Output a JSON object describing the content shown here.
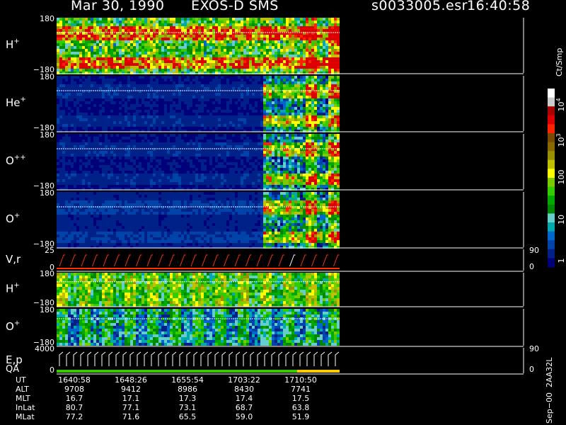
{
  "header": {
    "date": "Mar 30, 1990",
    "instrument": "EXOS-D SMS",
    "file": "s0033005.esr",
    "time": "16:40:58"
  },
  "panels": [
    {
      "label": "H",
      "sup": "+",
      "top_tick": "180",
      "bottom_tick": "−180"
    },
    {
      "label": "He",
      "sup": "+",
      "top_tick": "180",
      "bottom_tick": "−180"
    },
    {
      "label": "O",
      "sup": "++",
      "top_tick": "180",
      "bottom_tick": "−180"
    },
    {
      "label": "O",
      "sup": "+",
      "top_tick": "180",
      "bottom_tick": "−180"
    },
    {
      "label": "V,r",
      "sup": "",
      "top_tick": "25",
      "bottom_tick": "0",
      "right_top": "90",
      "right_bottom": "0"
    },
    {
      "label": "H",
      "sup": "+",
      "top_tick": "180",
      "bottom_tick": "−180"
    },
    {
      "label": "O",
      "sup": "+",
      "top_tick": "180",
      "bottom_tick": "−180"
    },
    {
      "label": "E,p",
      "sub_label": "QA",
      "top_tick": "4000",
      "bottom_tick": "0",
      "right_top": "90",
      "right_bottom": "0"
    }
  ],
  "colorbar": {
    "unit": "Ct/Smp",
    "labels": [
      "10",
      "10",
      "100",
      "10",
      "1"
    ],
    "sups": [
      "4",
      "3",
      "",
      "",
      ""
    ],
    "colors": [
      "#ffffff",
      "#cccccc",
      "#aa0000",
      "#dd0000",
      "#ff2200",
      "#7a4a00",
      "#8a6a00",
      "#9a9000",
      "#c0c000",
      "#ffff00",
      "#7acc00",
      "#33cc00",
      "#00aa00",
      "#008800",
      "#66cccc",
      "#00aaaa",
      "#0066cc",
      "#0044aa",
      "#002288",
      "#00007a"
    ]
  },
  "ephemeris": {
    "row_labels": [
      "UT",
      "ALT",
      "MLT",
      "InLat",
      "MLat"
    ],
    "columns": [
      [
        "1640:58",
        "9708",
        "16.7",
        "80.7",
        "77.2"
      ],
      [
        "1648:26",
        "9412",
        "17.1",
        "77.1",
        "71.6"
      ],
      [
        "1655:54",
        "8986",
        "17.3",
        "73.1",
        "65.5"
      ],
      [
        "1703:22",
        "8430",
        "17.4",
        "68.7",
        "59.0"
      ],
      [
        "1710:50",
        "7741",
        "17.5",
        "63.8",
        "51.9"
      ]
    ]
  },
  "footer_vertical": "Sep−00  2AA32L",
  "chart_data": {
    "type": "heatmap",
    "title": "Mar 30, 1990   EXOS-D SMS",
    "x_ticks": [
      "1640:58",
      "1648:26",
      "1655:54",
      "1703:22",
      "1710:50"
    ],
    "ylim_pitch": [
      -180,
      180
    ],
    "ylim_vr": [
      0,
      25
    ],
    "ylim_ep": [
      0,
      4000
    ],
    "color_scale": "log",
    "color_range": [
      1,
      10000
    ],
    "color_unit": "Ct/Smp"
  }
}
